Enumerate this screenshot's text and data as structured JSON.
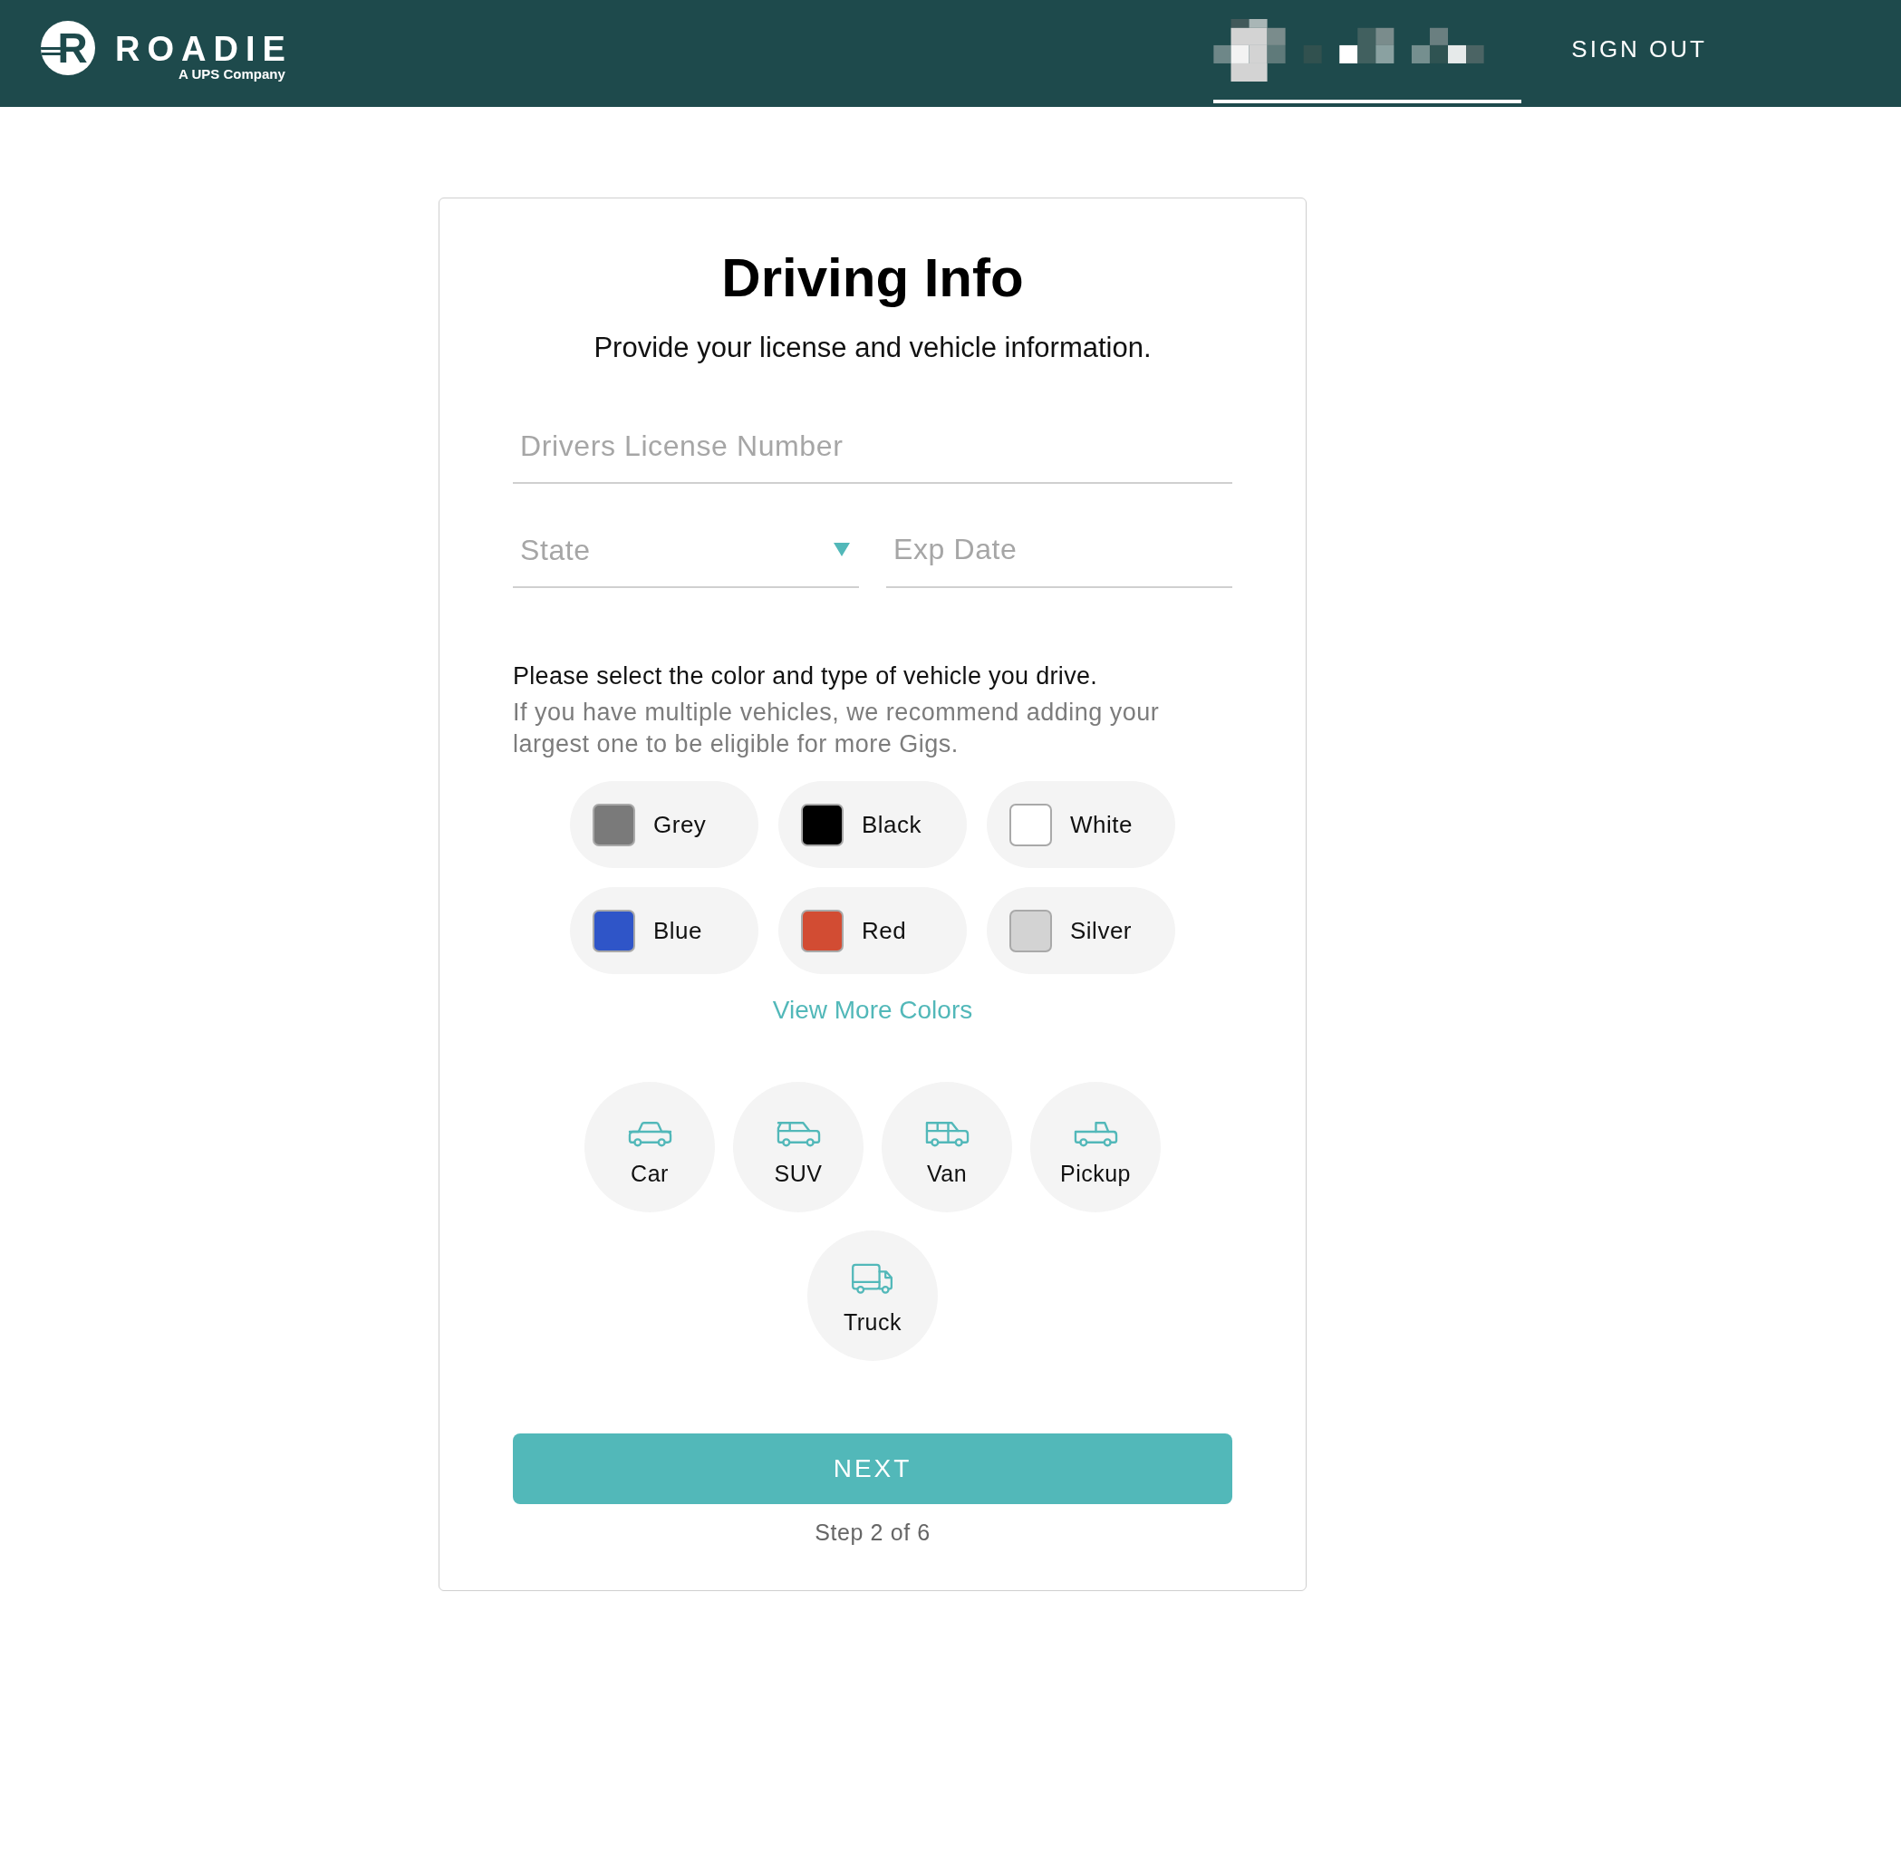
{
  "header": {
    "logo": {
      "mark": "R",
      "name": "ROADIE",
      "tagline": "A UPS Company"
    },
    "account_tab": {
      "selected": true
    },
    "sign_out": "SIGN OUT"
  },
  "card": {
    "title": "Driving Info",
    "subtitle": "Provide your license and vehicle information."
  },
  "license_field": {
    "placeholder": "Drivers License Number"
  },
  "state_field": {
    "placeholder": "State"
  },
  "exp_date_field": {
    "placeholder": "Exp Date"
  },
  "vehicle_prompt": "Please select the color and type of vehicle you drive.",
  "vehicle_hint": "If you have multiple vehicles, we recommend adding your largest one to be eligible for more Gigs.",
  "colors": [
    {
      "label": "Grey",
      "color": "#7a7a7a",
      "selected": false
    },
    {
      "label": "Black",
      "color": "#000000",
      "selected": false
    },
    {
      "label": "White",
      "color": "#ffffff",
      "selected": false
    },
    {
      "label": "Blue",
      "color": "#2f55c8",
      "selected": false
    },
    {
      "label": "Red",
      "color": "#d24c33",
      "selected": false
    },
    {
      "label": "Silver",
      "color": "#d3d3d3",
      "selected": false
    }
  ],
  "view_more_link": "View More Colors",
  "vehicles": [
    {
      "label": "Car",
      "kind": "car",
      "selected": false
    },
    {
      "label": "SUV",
      "kind": "suv",
      "selected": false
    },
    {
      "label": "Van",
      "kind": "van",
      "selected": false
    },
    {
      "label": "Pickup",
      "kind": "pickup",
      "selected": false
    },
    {
      "label": "Truck",
      "kind": "truck",
      "selected": false
    }
  ],
  "next_button": "NEXT",
  "step": "Step 2 of 6"
}
